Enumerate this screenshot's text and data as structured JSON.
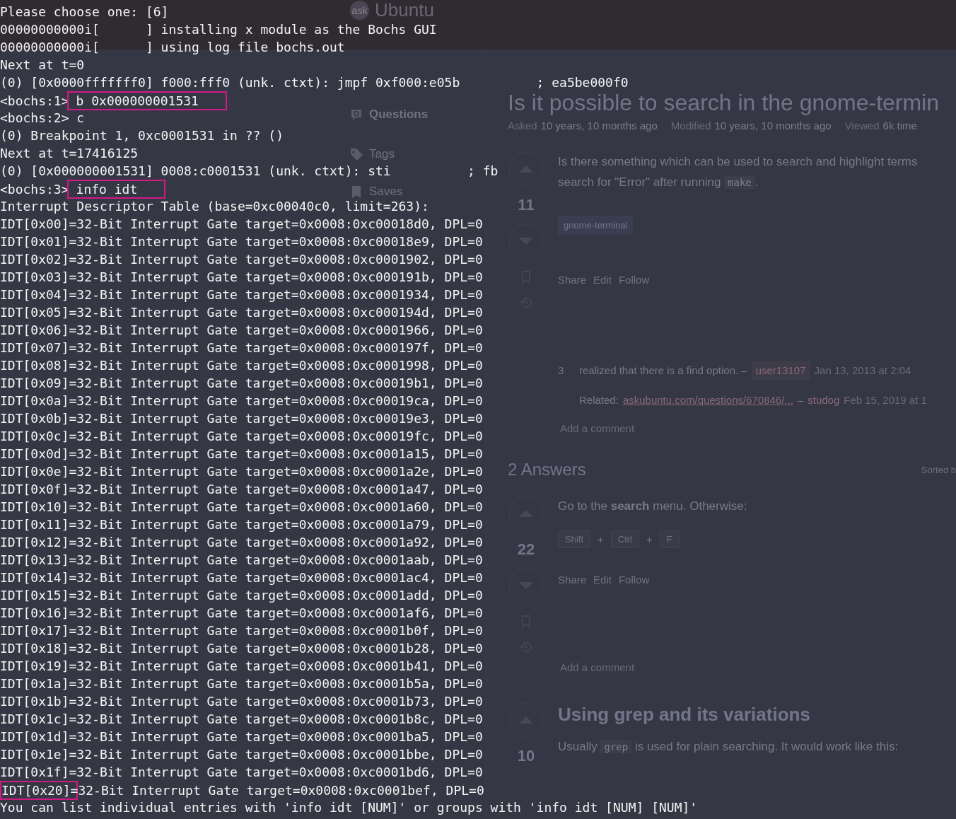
{
  "page": {
    "logo": {
      "mark": "ask",
      "name": "Ubuntu"
    },
    "sidebar": {
      "items": [
        {
          "kind": "questions",
          "label": "Questions",
          "selected": true
        },
        {
          "kind": "tags",
          "label": "Tags",
          "selected": false
        },
        {
          "kind": "saves",
          "label": "Saves",
          "selected": false
        }
      ]
    },
    "question": {
      "title": "Is it possible to search in the gnome-termin",
      "meta": [
        {
          "label": "Asked",
          "value": "10 years, 10 months ago"
        },
        {
          "label": "Modified",
          "value": "10 years, 10 months ago"
        },
        {
          "label": "Viewed",
          "value": "6k time"
        }
      ],
      "votes": "11",
      "body": [
        {
          "segments": [
            {
              "kind": "text",
              "text": "Is there something which can be used to search and highlight terms"
            }
          ]
        },
        {
          "segments": [
            {
              "kind": "text",
              "text": "search for \"Error\" after running "
            },
            {
              "kind": "code",
              "text": "make"
            },
            {
              "kind": "text",
              "text": "."
            }
          ]
        }
      ],
      "tags": [
        "gnome-terminal"
      ],
      "actions": [
        "Share",
        "Edit",
        "Follow"
      ],
      "comments": [
        {
          "score": "3",
          "text": "realized that there is a find option. –",
          "user": "user13107",
          "time": "Jan 13, 2013 at 2:04"
        },
        {
          "text": "Related:",
          "link": "askubuntu.com/questions/670846/...",
          "dash": "–",
          "user": "studog",
          "time": "Feb 15, 2019 at 1"
        }
      ],
      "add_comment": "Add a comment"
    },
    "answers_header": {
      "count": "2 Answers",
      "sort": "Sorted b"
    },
    "answers": [
      {
        "votes": "22",
        "blocks": [
          {
            "kind": "paragraph",
            "segments": [
              {
                "kind": "text",
                "text": "Go to the "
              },
              {
                "kind": "bold",
                "text": "search"
              },
              {
                "kind": "text",
                "text": " menu. Otherwise:"
              }
            ]
          },
          {
            "kind": "keys",
            "keys": [
              {
                "kind": "key",
                "text": "Shift"
              },
              {
                "kind": "plus",
                "text": "+"
              },
              {
                "kind": "key",
                "text": "Ctrl"
              },
              {
                "kind": "plus",
                "text": "+"
              },
              {
                "kind": "key",
                "text": "F"
              }
            ]
          }
        ],
        "actions": [
          "Share",
          "Edit",
          "Follow"
        ],
        "add_comment": "Add a comment"
      },
      {
        "votes": "10",
        "blocks": [
          {
            "kind": "heading",
            "text": "Using grep and its variations"
          },
          {
            "kind": "paragraph",
            "segments": [
              {
                "kind": "text",
                "text": "Usually "
              },
              {
                "kind": "code",
                "text": "grep"
              },
              {
                "kind": "text",
                "text": " is used for plain searching. It would work like this:"
              }
            ]
          }
        ]
      }
    ]
  },
  "terminal": {
    "lines": [
      {
        "kind": "plain",
        "text": "Please choose one: [6]"
      },
      {
        "kind": "plain",
        "text": "00000000000i[      ] installing x module as the Bochs GUI"
      },
      {
        "kind": "plain",
        "text": "00000000000i[      ] using log file bochs.out"
      },
      {
        "kind": "plain",
        "text": "Next at t=0"
      },
      {
        "kind": "split",
        "text": "(0) [0x0000fffffff0] f000:fff0 (unk. ctxt): jmpf 0xf000:e05b",
        "comment": "; ea5be000f0"
      },
      {
        "kind": "marked",
        "before": "<bochs:1>",
        "marked": "b 0x000000001531"
      },
      {
        "kind": "plain",
        "text": "<bochs:2> c"
      },
      {
        "kind": "plain",
        "text": "(0) Breakpoint 1, 0xc0001531 in ?? ()"
      },
      {
        "kind": "plain",
        "text": "Next at t=17416125"
      },
      {
        "kind": "split",
        "text": "(0) [0x000000001531] 0008:c0001531 (unk. ctxt): sti",
        "comment": "; fb"
      },
      {
        "kind": "marked",
        "before": "<bochs:3>",
        "marked": "info idt"
      },
      {
        "kind": "plain",
        "text": "Interrupt Descriptor Table (base=0xc00040c0, limit=263):"
      },
      {
        "kind": "plain",
        "text": "IDT[0x00]=32-Bit Interrupt Gate target=0x0008:0xc00018d0, DPL=0"
      },
      {
        "kind": "plain",
        "text": "IDT[0x01]=32-Bit Interrupt Gate target=0x0008:0xc00018e9, DPL=0"
      },
      {
        "kind": "plain",
        "text": "IDT[0x02]=32-Bit Interrupt Gate target=0x0008:0xc0001902, DPL=0"
      },
      {
        "kind": "plain",
        "text": "IDT[0x03]=32-Bit Interrupt Gate target=0x0008:0xc000191b, DPL=0"
      },
      {
        "kind": "plain",
        "text": "IDT[0x04]=32-Bit Interrupt Gate target=0x0008:0xc0001934, DPL=0"
      },
      {
        "kind": "plain",
        "text": "IDT[0x05]=32-Bit Interrupt Gate target=0x0008:0xc000194d, DPL=0"
      },
      {
        "kind": "plain",
        "text": "IDT[0x06]=32-Bit Interrupt Gate target=0x0008:0xc0001966, DPL=0"
      },
      {
        "kind": "plain",
        "text": "IDT[0x07]=32-Bit Interrupt Gate target=0x0008:0xc000197f, DPL=0"
      },
      {
        "kind": "plain",
        "text": "IDT[0x08]=32-Bit Interrupt Gate target=0x0008:0xc0001998, DPL=0"
      },
      {
        "kind": "plain",
        "text": "IDT[0x09]=32-Bit Interrupt Gate target=0x0008:0xc00019b1, DPL=0"
      },
      {
        "kind": "plain",
        "text": "IDT[0x0a]=32-Bit Interrupt Gate target=0x0008:0xc00019ca, DPL=0"
      },
      {
        "kind": "plain",
        "text": "IDT[0x0b]=32-Bit Interrupt Gate target=0x0008:0xc00019e3, DPL=0"
      },
      {
        "kind": "plain",
        "text": "IDT[0x0c]=32-Bit Interrupt Gate target=0x0008:0xc00019fc, DPL=0"
      },
      {
        "kind": "plain",
        "text": "IDT[0x0d]=32-Bit Interrupt Gate target=0x0008:0xc0001a15, DPL=0"
      },
      {
        "kind": "plain",
        "text": "IDT[0x0e]=32-Bit Interrupt Gate target=0x0008:0xc0001a2e, DPL=0"
      },
      {
        "kind": "plain",
        "text": "IDT[0x0f]=32-Bit Interrupt Gate target=0x0008:0xc0001a47, DPL=0"
      },
      {
        "kind": "plain",
        "text": "IDT[0x10]=32-Bit Interrupt Gate target=0x0008:0xc0001a60, DPL=0"
      },
      {
        "kind": "plain",
        "text": "IDT[0x11]=32-Bit Interrupt Gate target=0x0008:0xc0001a79, DPL=0"
      },
      {
        "kind": "plain",
        "text": "IDT[0x12]=32-Bit Interrupt Gate target=0x0008:0xc0001a92, DPL=0"
      },
      {
        "kind": "plain",
        "text": "IDT[0x13]=32-Bit Interrupt Gate target=0x0008:0xc0001aab, DPL=0"
      },
      {
        "kind": "plain",
        "text": "IDT[0x14]=32-Bit Interrupt Gate target=0x0008:0xc0001ac4, DPL=0"
      },
      {
        "kind": "plain",
        "text": "IDT[0x15]=32-Bit Interrupt Gate target=0x0008:0xc0001add, DPL=0"
      },
      {
        "kind": "plain",
        "text": "IDT[0x16]=32-Bit Interrupt Gate target=0x0008:0xc0001af6, DPL=0"
      },
      {
        "kind": "plain",
        "text": "IDT[0x17]=32-Bit Interrupt Gate target=0x0008:0xc0001b0f, DPL=0"
      },
      {
        "kind": "plain",
        "text": "IDT[0x18]=32-Bit Interrupt Gate target=0x0008:0xc0001b28, DPL=0"
      },
      {
        "kind": "plain",
        "text": "IDT[0x19]=32-Bit Interrupt Gate target=0x0008:0xc0001b41, DPL=0"
      },
      {
        "kind": "plain",
        "text": "IDT[0x1a]=32-Bit Interrupt Gate target=0x0008:0xc0001b5a, DPL=0"
      },
      {
        "kind": "plain",
        "text": "IDT[0x1b]=32-Bit Interrupt Gate target=0x0008:0xc0001b73, DPL=0"
      },
      {
        "kind": "plain",
        "text": "IDT[0x1c]=32-Bit Interrupt Gate target=0x0008:0xc0001b8c, DPL=0"
      },
      {
        "kind": "plain",
        "text": "IDT[0x1d]=32-Bit Interrupt Gate target=0x0008:0xc0001ba5, DPL=0"
      },
      {
        "kind": "plain",
        "text": "IDT[0x1e]=32-Bit Interrupt Gate target=0x0008:0xc0001bbe, DPL=0"
      },
      {
        "kind": "plain",
        "text": "IDT[0x1f]=32-Bit Interrupt Gate target=0x0008:0xc0001bd6, DPL=0"
      },
      {
        "kind": "marked",
        "marked": "IDT[0x20]",
        "after": "=32-Bit Interrupt Gate target=0x0008:0xc0001bef, DPL=0"
      },
      {
        "kind": "plain",
        "text": "You can list individual entries with 'info idt [NUM]' or groups with 'info idt [NUM] [NUM]'"
      }
    ]
  }
}
